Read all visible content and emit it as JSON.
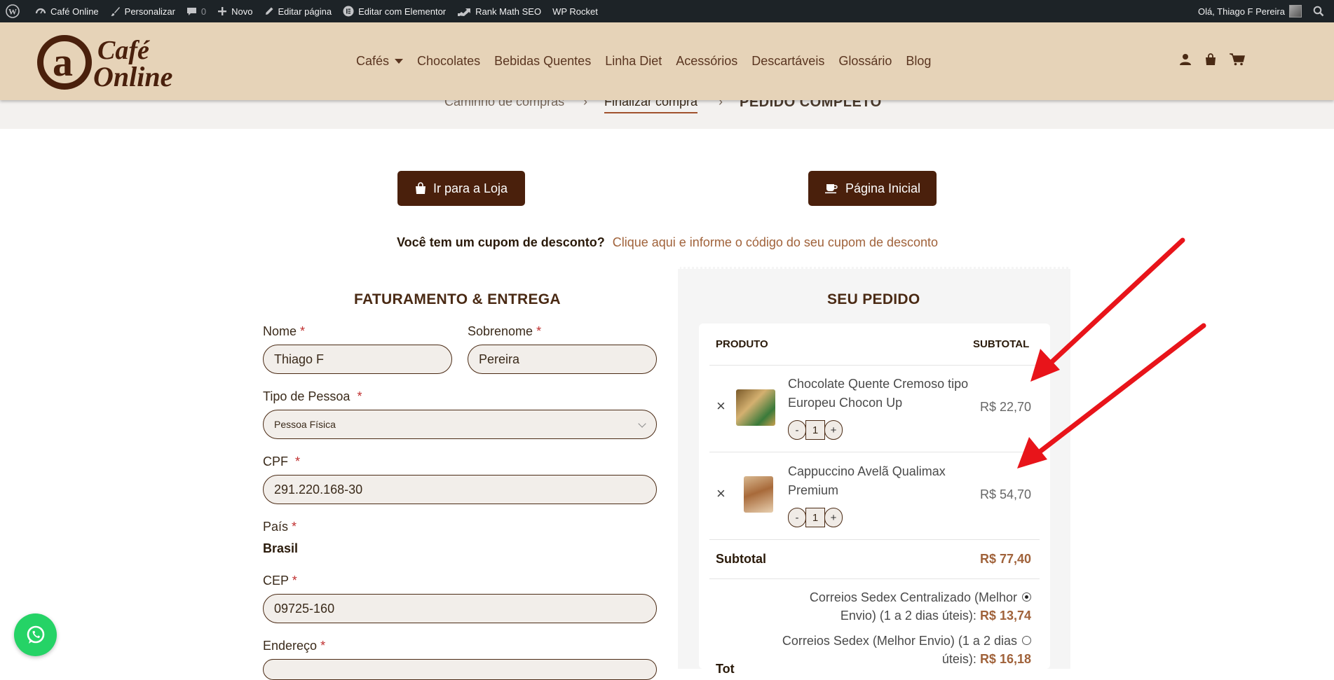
{
  "adminbar": {
    "site_name": "Café Online",
    "customize": "Personalizar",
    "comments_count": "0",
    "new": "Novo",
    "edit_page": "Editar página",
    "edit_elementor": "Editar com Elementor",
    "rank_math": "Rank Math SEO",
    "wp_rocket": "WP Rocket",
    "greeting": "Olá, Thiago F Pereira"
  },
  "header": {
    "logo_line1": "Café",
    "logo_line2": "Online",
    "nav": [
      "Cafés",
      "Chocolates",
      "Bebidas Quentes",
      "Linha Diet",
      "Acessórios",
      "Descartáveis",
      "Glossário",
      "Blog"
    ]
  },
  "steps": {
    "step1": "Caminho de compras",
    "step2": "Finalizar compra",
    "step3": "PEDIDO COMPLETO",
    "separator": "›"
  },
  "buttons": {
    "shop": "Ir para a Loja",
    "home": "Página Inicial"
  },
  "coupon": {
    "question": "Você tem um cupom de desconto?",
    "link": "Clique aqui e informe o código do seu cupom de desconto"
  },
  "billing": {
    "title": "FATURAMENTO & ENTREGA",
    "first_name_label": "Nome",
    "first_name_value": "Thiago F",
    "last_name_label": "Sobrenome",
    "last_name_value": "Pereira",
    "person_type_label": "Tipo de Pessoa",
    "person_type_value": "Pessoa Física",
    "cpf_label": "CPF",
    "cpf_value": "291.220.168-30",
    "country_label": "País",
    "country_value": "Brasil",
    "cep_label": "CEP",
    "cep_value": "09725-160",
    "address_label": "Endereço",
    "required_mark": "*"
  },
  "order": {
    "title": "SEU PEDIDO",
    "col_product": "PRODUTO",
    "col_subtotal": "SUBTOTAL",
    "items": [
      {
        "name": "Chocolate Quente Cremoso tipo Europeu Chocon Up",
        "qty": "1",
        "price": "R$ 22,70"
      },
      {
        "name": "Cappuccino Avelã Qualimax Premium",
        "qty": "1",
        "price": "R$ 54,70"
      }
    ],
    "qty_minus": "-",
    "qty_plus": "+",
    "remove": "×",
    "subtotal_label": "Subtotal",
    "subtotal_value": "R$ 77,40",
    "shipping": [
      {
        "line1": "Correios Sedex Centralizado (Melhor",
        "line2": "Envio) (1 a 2 dias úteis):",
        "price": "R$ 13,74",
        "selected": true
      },
      {
        "line1": "Correios Sedex (Melhor Envio) (1 a 2 dias",
        "line2": "úteis):",
        "price": "R$ 16,18",
        "selected": false
      }
    ],
    "total_partial": "Tot"
  },
  "colors": {
    "brand_brown": "#4a200c",
    "header_bg": "#e6d3b8",
    "accent_price": "#a0623a",
    "annotation_arrow": "#e8141a",
    "whatsapp": "#25d366"
  }
}
